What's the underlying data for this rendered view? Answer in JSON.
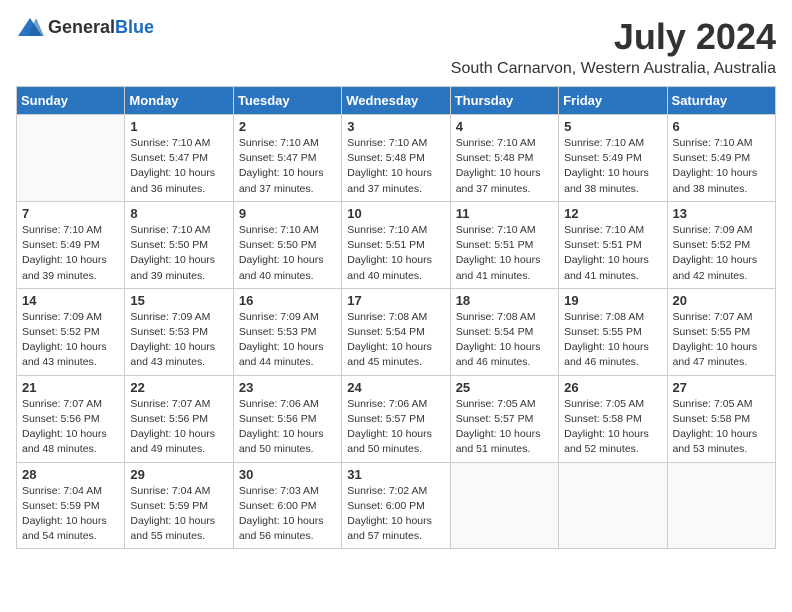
{
  "header": {
    "logo_general": "General",
    "logo_blue": "Blue",
    "title": "July 2024",
    "subtitle": "South Carnarvon, Western Australia, Australia"
  },
  "days_of_week": [
    "Sunday",
    "Monday",
    "Tuesday",
    "Wednesday",
    "Thursday",
    "Friday",
    "Saturday"
  ],
  "weeks": [
    [
      {
        "day": "",
        "info": ""
      },
      {
        "day": "1",
        "info": "Sunrise: 7:10 AM\nSunset: 5:47 PM\nDaylight: 10 hours\nand 36 minutes."
      },
      {
        "day": "2",
        "info": "Sunrise: 7:10 AM\nSunset: 5:47 PM\nDaylight: 10 hours\nand 37 minutes."
      },
      {
        "day": "3",
        "info": "Sunrise: 7:10 AM\nSunset: 5:48 PM\nDaylight: 10 hours\nand 37 minutes."
      },
      {
        "day": "4",
        "info": "Sunrise: 7:10 AM\nSunset: 5:48 PM\nDaylight: 10 hours\nand 37 minutes."
      },
      {
        "day": "5",
        "info": "Sunrise: 7:10 AM\nSunset: 5:49 PM\nDaylight: 10 hours\nand 38 minutes."
      },
      {
        "day": "6",
        "info": "Sunrise: 7:10 AM\nSunset: 5:49 PM\nDaylight: 10 hours\nand 38 minutes."
      }
    ],
    [
      {
        "day": "7",
        "info": "Sunrise: 7:10 AM\nSunset: 5:49 PM\nDaylight: 10 hours\nand 39 minutes."
      },
      {
        "day": "8",
        "info": "Sunrise: 7:10 AM\nSunset: 5:50 PM\nDaylight: 10 hours\nand 39 minutes."
      },
      {
        "day": "9",
        "info": "Sunrise: 7:10 AM\nSunset: 5:50 PM\nDaylight: 10 hours\nand 40 minutes."
      },
      {
        "day": "10",
        "info": "Sunrise: 7:10 AM\nSunset: 5:51 PM\nDaylight: 10 hours\nand 40 minutes."
      },
      {
        "day": "11",
        "info": "Sunrise: 7:10 AM\nSunset: 5:51 PM\nDaylight: 10 hours\nand 41 minutes."
      },
      {
        "day": "12",
        "info": "Sunrise: 7:10 AM\nSunset: 5:51 PM\nDaylight: 10 hours\nand 41 minutes."
      },
      {
        "day": "13",
        "info": "Sunrise: 7:09 AM\nSunset: 5:52 PM\nDaylight: 10 hours\nand 42 minutes."
      }
    ],
    [
      {
        "day": "14",
        "info": "Sunrise: 7:09 AM\nSunset: 5:52 PM\nDaylight: 10 hours\nand 43 minutes."
      },
      {
        "day": "15",
        "info": "Sunrise: 7:09 AM\nSunset: 5:53 PM\nDaylight: 10 hours\nand 43 minutes."
      },
      {
        "day": "16",
        "info": "Sunrise: 7:09 AM\nSunset: 5:53 PM\nDaylight: 10 hours\nand 44 minutes."
      },
      {
        "day": "17",
        "info": "Sunrise: 7:08 AM\nSunset: 5:54 PM\nDaylight: 10 hours\nand 45 minutes."
      },
      {
        "day": "18",
        "info": "Sunrise: 7:08 AM\nSunset: 5:54 PM\nDaylight: 10 hours\nand 46 minutes."
      },
      {
        "day": "19",
        "info": "Sunrise: 7:08 AM\nSunset: 5:55 PM\nDaylight: 10 hours\nand 46 minutes."
      },
      {
        "day": "20",
        "info": "Sunrise: 7:07 AM\nSunset: 5:55 PM\nDaylight: 10 hours\nand 47 minutes."
      }
    ],
    [
      {
        "day": "21",
        "info": "Sunrise: 7:07 AM\nSunset: 5:56 PM\nDaylight: 10 hours\nand 48 minutes."
      },
      {
        "day": "22",
        "info": "Sunrise: 7:07 AM\nSunset: 5:56 PM\nDaylight: 10 hours\nand 49 minutes."
      },
      {
        "day": "23",
        "info": "Sunrise: 7:06 AM\nSunset: 5:56 PM\nDaylight: 10 hours\nand 50 minutes."
      },
      {
        "day": "24",
        "info": "Sunrise: 7:06 AM\nSunset: 5:57 PM\nDaylight: 10 hours\nand 50 minutes."
      },
      {
        "day": "25",
        "info": "Sunrise: 7:05 AM\nSunset: 5:57 PM\nDaylight: 10 hours\nand 51 minutes."
      },
      {
        "day": "26",
        "info": "Sunrise: 7:05 AM\nSunset: 5:58 PM\nDaylight: 10 hours\nand 52 minutes."
      },
      {
        "day": "27",
        "info": "Sunrise: 7:05 AM\nSunset: 5:58 PM\nDaylight: 10 hours\nand 53 minutes."
      }
    ],
    [
      {
        "day": "28",
        "info": "Sunrise: 7:04 AM\nSunset: 5:59 PM\nDaylight: 10 hours\nand 54 minutes."
      },
      {
        "day": "29",
        "info": "Sunrise: 7:04 AM\nSunset: 5:59 PM\nDaylight: 10 hours\nand 55 minutes."
      },
      {
        "day": "30",
        "info": "Sunrise: 7:03 AM\nSunset: 6:00 PM\nDaylight: 10 hours\nand 56 minutes."
      },
      {
        "day": "31",
        "info": "Sunrise: 7:02 AM\nSunset: 6:00 PM\nDaylight: 10 hours\nand 57 minutes."
      },
      {
        "day": "",
        "info": ""
      },
      {
        "day": "",
        "info": ""
      },
      {
        "day": "",
        "info": ""
      }
    ]
  ]
}
